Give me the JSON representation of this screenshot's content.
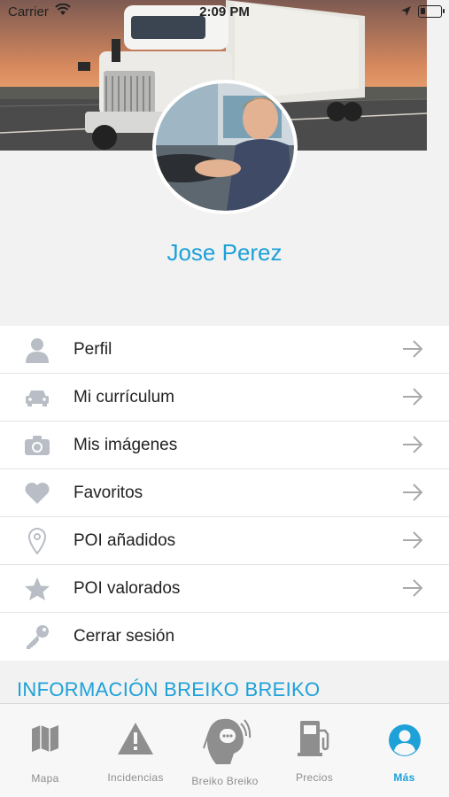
{
  "status": {
    "carrier": "Carrier",
    "time": "2:09 PM"
  },
  "profile": {
    "name": "Jose Perez"
  },
  "menu": {
    "items": [
      {
        "label": "Perfil",
        "icon": "person-icon"
      },
      {
        "label": "Mi currículum",
        "icon": "car-icon"
      },
      {
        "label": "Mis imágenes",
        "icon": "camera-icon"
      },
      {
        "label": "Favoritos",
        "icon": "heart-icon"
      },
      {
        "label": "POI añadidos",
        "icon": "location-pin-icon"
      },
      {
        "label": "POI valorados",
        "icon": "star-icon"
      },
      {
        "label": "Cerrar sesión",
        "icon": "key-icon"
      }
    ]
  },
  "section": {
    "title": "INFORMACIÓN BREIKO BREIKO"
  },
  "tabbar": {
    "tabs": [
      {
        "label": "Mapa",
        "icon": "map-icon",
        "active": false
      },
      {
        "label": "Incidencias",
        "icon": "warning-icon",
        "active": false
      },
      {
        "label": "Breiko Breiko",
        "icon": "radio-head-icon",
        "active": false
      },
      {
        "label": "Precios",
        "icon": "fuel-pump-icon",
        "active": false
      },
      {
        "label": "Más",
        "icon": "user-circle-icon",
        "active": true
      }
    ]
  },
  "colors": {
    "accent": "#1da1d8",
    "icon_gray": "#b9bec6",
    "arrow_gray": "#a9a9a9",
    "tab_gray": "#8e8e8e"
  }
}
